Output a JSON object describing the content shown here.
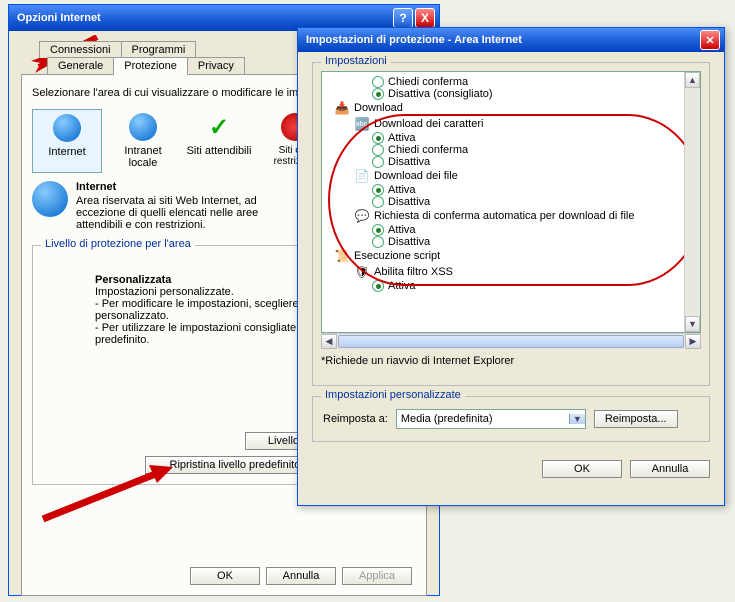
{
  "win1": {
    "title": "Opzioni Internet",
    "help": "?",
    "close": "X",
    "tabs_row1": [
      "Connessioni",
      "Programmi"
    ],
    "tabs_row2": [
      "Generale",
      "Protezione",
      "Privacy"
    ],
    "instruction": "Selezionare l'area di cui visualizzare o modificare le impostazioni.",
    "zones": {
      "internet": "Internet",
      "intranet": "Intranet locale",
      "trusted": "Siti attendibili",
      "restricted": "Siti con restrizioni"
    },
    "zone_desc": {
      "title": "Internet",
      "body1": "Area riservata ai siti Web Internet, ad",
      "body2": "eccezione di quelli elencati nelle aree",
      "body3": "attendibili e con restrizioni."
    },
    "sec_level_legend": "Livello di protezione per l'area",
    "custom_title": "Personalizzata",
    "custom_lines": [
      "Impostazioni personalizzate.",
      "- Per modificare le impostazioni, scegliere Livello personalizzato.",
      "- Per utilizzare le impostazioni consigliate, scegliere Livello predefinito."
    ],
    "btn_custom": "Livello personalizzato...",
    "btn_default": "Ripristina livello predefinito per tutte le aree",
    "btn_ok": "OK",
    "btn_cancel": "Annulla",
    "btn_apply": "Applica"
  },
  "win2": {
    "title": "Impostazioni di protezione - Area Internet",
    "legend_settings": "Impostazioni",
    "tree": {
      "opt_prompt": "Chiedi conferma",
      "opt_disable_rec": "Disattiva (consigliato)",
      "grp_download": "Download",
      "sub_fontdl": "Download dei caratteri",
      "opt_enable": "Attiva",
      "opt_prompt2": "Chiedi conferma",
      "opt_disable": "Disattiva",
      "sub_filedl": "Download dei file",
      "sub_autoprompt": "Richiesta di conferma automatica per download di file",
      "grp_script": "Esecuzione script",
      "sub_xss": "Abilita filtro XSS"
    },
    "note": "*Richiede un riavvio di Internet Explorer",
    "legend_custom": "Impostazioni personalizzate",
    "reset_to": "Reimposta a:",
    "reset_value": "Media (predefinita)",
    "btn_reset": "Reimposta...",
    "btn_ok": "OK",
    "btn_cancel": "Annulla"
  }
}
